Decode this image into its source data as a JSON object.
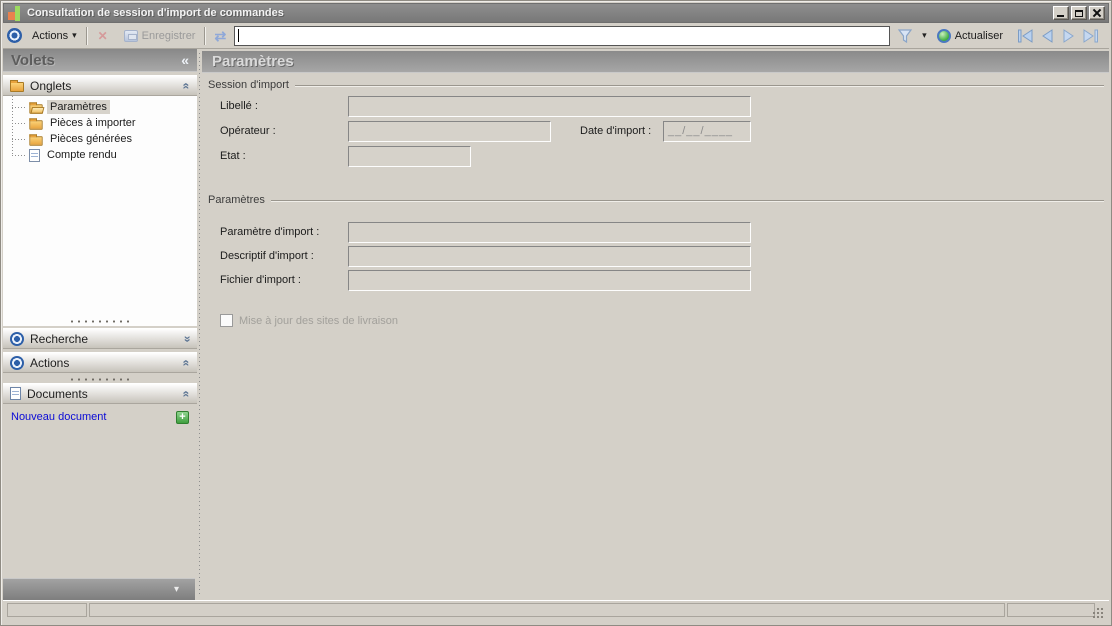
{
  "window": {
    "title": "Consultation de session d'import de commandes"
  },
  "toolbar": {
    "actions_label": "Actions",
    "save_label": "Enregistrer",
    "refresh_label": "Actualiser",
    "search_value": ""
  },
  "icons": {
    "dropdown_caret": "▾",
    "collapse_chevrons": "«",
    "chevron_double": "«",
    "delete_x": "✕",
    "sync_arrows": "⇄",
    "plus": "+",
    "bottom_caret": "▾"
  },
  "sidebar": {
    "title": "Volets",
    "sections": {
      "onglets": "Onglets",
      "recherche": "Recherche",
      "actions": "Actions",
      "documents": "Documents"
    },
    "tree": [
      {
        "label": "Paramètres",
        "selected": true,
        "icon": "open-folder"
      },
      {
        "label": "Pièces à importer",
        "selected": false,
        "icon": "folder"
      },
      {
        "label": "Pièces générées",
        "selected": false,
        "icon": "folder"
      },
      {
        "label": "Compte rendu",
        "selected": false,
        "icon": "document"
      }
    ],
    "new_document_label": "Nouveau document"
  },
  "main": {
    "title": "Paramètres",
    "session_group": {
      "title": "Session d'import",
      "libelle_label": "Libellé :",
      "libelle_value": "",
      "operateur_label": "Opérateur :",
      "operateur_value": "",
      "date_label": "Date d'import :",
      "date_value": "__/__/____",
      "etat_label": "Etat :",
      "etat_value": ""
    },
    "params_group": {
      "title": "Paramètres",
      "param_label": "Paramètre d'import :",
      "param_value": "",
      "descriptif_label": "Descriptif d'import :",
      "descriptif_value": "",
      "fichier_label": "Fichier d'import :",
      "fichier_value": ""
    },
    "checkbox_label": "Mise à jour des sites de livraison",
    "checkbox_checked": false
  },
  "colors": {
    "chrome": "#d4d0c8",
    "titlebar": "#808080",
    "accent_blue": "#2d5fa8",
    "folder_yellow": "#f0c060",
    "link_blue": "#0b0bd6",
    "plus_green": "#3f9f3f",
    "disabled_text": "#9a9a9a"
  }
}
